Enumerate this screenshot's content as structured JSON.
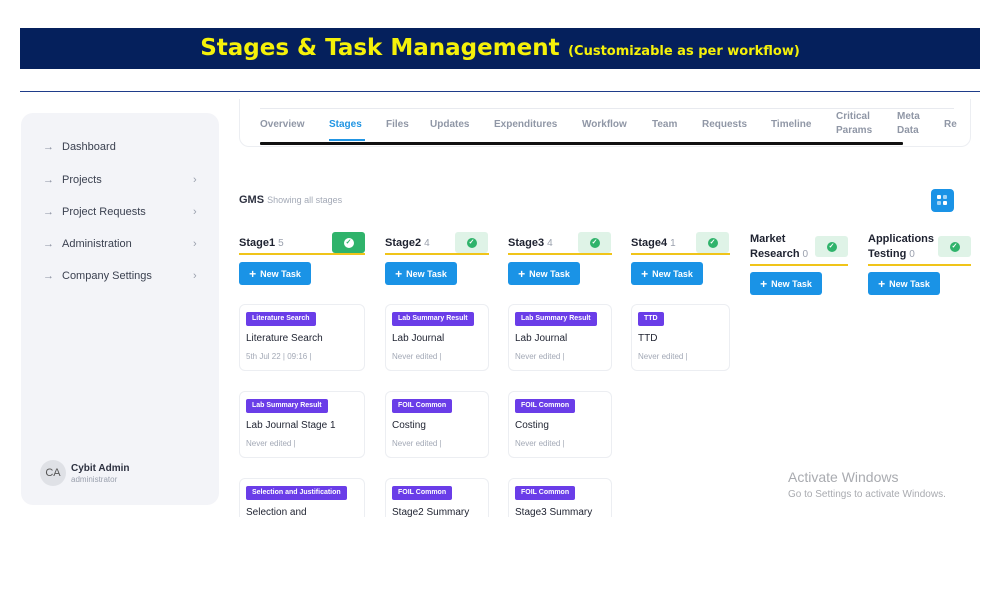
{
  "banner": {
    "title": "Stages & Task Management",
    "subtitle": "(Customizable as per workflow)"
  },
  "sidebar": {
    "items": [
      {
        "label": "Dashboard",
        "has_chevron": false
      },
      {
        "label": "Projects",
        "has_chevron": true
      },
      {
        "label": "Project Requests",
        "has_chevron": true
      },
      {
        "label": "Administration",
        "has_chevron": true
      },
      {
        "label": "Company Settings",
        "has_chevron": true
      }
    ],
    "arrow_glyph": "→",
    "chevron_glyph": "›",
    "user": {
      "initials": "CA",
      "name": "Cybit Admin",
      "role": "administrator"
    }
  },
  "tabs": {
    "items": [
      "Overview",
      "Stages",
      "Files",
      "Updates",
      "Expenditures",
      "Workflow",
      "Team",
      "Requests",
      "Timeline",
      "Critical Params",
      "Meta Data",
      "Re"
    ],
    "active": "Stages"
  },
  "board": {
    "title": "GMS",
    "subtitle": "Showing all stages",
    "new_task_label": "New Task",
    "plus_glyph": "+",
    "check_glyph": "✓",
    "accent_color": "#1a93e6",
    "badge_color": "#6a3de8",
    "stage_underline_color": "#f0c419",
    "columns": [
      {
        "name": "Stage1",
        "count": "5",
        "check_style": "dark",
        "cards": [
          {
            "badge": "Literature Search",
            "title": "Literature Search",
            "meta": "5th Jul 22 | 09:16 |"
          },
          {
            "badge": "Lab Summary Result",
            "title": "Lab Journal Stage 1",
            "meta": "Never edited |"
          },
          {
            "badge": "Selection and Justification",
            "title": "Selection and",
            "meta": ""
          }
        ]
      },
      {
        "name": "Stage2",
        "count": "4",
        "check_style": "light",
        "cards": [
          {
            "badge": "Lab Summary Result",
            "title": "Lab Journal",
            "meta": "Never edited |"
          },
          {
            "badge": "FOIL Common",
            "title": "Costing",
            "meta": "Never edited |"
          },
          {
            "badge": "FOIL Common",
            "title": "Stage2 Summary",
            "meta": ""
          }
        ]
      },
      {
        "name": "Stage3",
        "count": "4",
        "check_style": "light",
        "cards": [
          {
            "badge": "Lab Summary Result",
            "title": "Lab Journal",
            "meta": "Never edited |"
          },
          {
            "badge": "FOIL Common",
            "title": "Costing",
            "meta": "Never edited |"
          },
          {
            "badge": "FOIL Common",
            "title": "Stage3 Summary",
            "meta": ""
          }
        ]
      },
      {
        "name": "Stage4",
        "count": "1",
        "check_style": "light",
        "cards": [
          {
            "badge": "TTD",
            "title": "TTD",
            "meta": "Never edited |"
          }
        ]
      },
      {
        "name": "Market Research",
        "count": "0",
        "check_style": "light",
        "cards": []
      },
      {
        "name": "Applications Testing",
        "count": "0",
        "check_style": "light",
        "cards": []
      }
    ]
  },
  "watermark": {
    "line1": "Activate Windows",
    "line2": "Go to Settings to activate Windows."
  }
}
